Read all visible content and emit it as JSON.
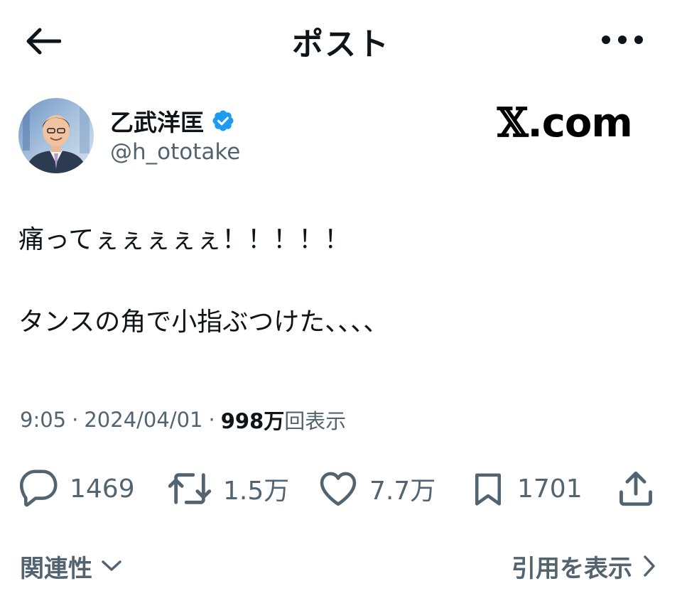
{
  "header": {
    "title": "ポスト",
    "back_icon": "arrow-left-icon",
    "more_icon": "more-horizontal-icon"
  },
  "author": {
    "display_name": "乙武洋匡",
    "handle": "@h_ototake",
    "verified_color": "#1d9bf0"
  },
  "watermark": {
    "x": "𝕏",
    "rest": ".com"
  },
  "post": {
    "lines": [
      "痛ってぇぇぇぇぇ！！！！！",
      "タンスの角で小指ぶつけた、、、、"
    ],
    "time": "9:05",
    "date": "2024/04/01",
    "views_count": "998万",
    "views_label": "回表示"
  },
  "actions": {
    "reply": {
      "icon": "reply-icon",
      "count": "1469"
    },
    "repost": {
      "icon": "repost-icon",
      "count": "1.5万"
    },
    "like": {
      "icon": "heart-icon",
      "count": "7.7万"
    },
    "bookmark": {
      "icon": "bookmark-icon",
      "count": "1701"
    },
    "share": {
      "icon": "share-icon"
    }
  },
  "footer": {
    "sort_label": "関連性",
    "quotes_label": "引用を表示"
  },
  "colors": {
    "text": "#0f1419",
    "secondary": "#536471",
    "accent": "#1d9bf0"
  }
}
